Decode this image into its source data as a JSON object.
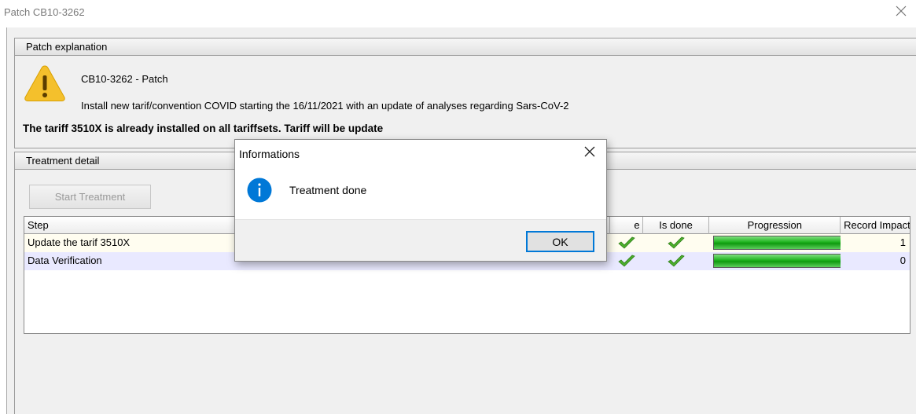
{
  "window": {
    "title": "Patch CB10-3262"
  },
  "explanation": {
    "header": "Patch explanation",
    "title": "CB10-3262 - Patch",
    "description": "Install new tarif/convention COVID starting the 16/11/2021 with an update of analyses regarding Sars-CoV-2",
    "notice": "The tariff 3510X is already installed on all tariffsets. Tariff will be update",
    "icon": "warning-icon"
  },
  "treatment": {
    "header": "Treatment detail",
    "start_button": "Start Treatment",
    "columns": {
      "step": "Step",
      "done_partial": "e",
      "is_done": "Is done",
      "progression": "Progression",
      "record": "Record Impacted"
    },
    "rows": [
      {
        "step": "Update the tarif 3510X",
        "done": true,
        "is_done": true,
        "progress": 1.0,
        "records": "1"
      },
      {
        "step": "Data Verification",
        "done": true,
        "is_done": true,
        "progress": 1.0,
        "records": "0"
      }
    ],
    "colors": {
      "row_odd": "#fffdf0",
      "row_even": "#e9e9ff",
      "progress": "#1fb31f",
      "check": "#4caf2c"
    }
  },
  "dialog": {
    "title": "Informations",
    "message": "Treatment done",
    "ok": "OK",
    "icon": "info-icon",
    "accent": "#0078d7"
  }
}
